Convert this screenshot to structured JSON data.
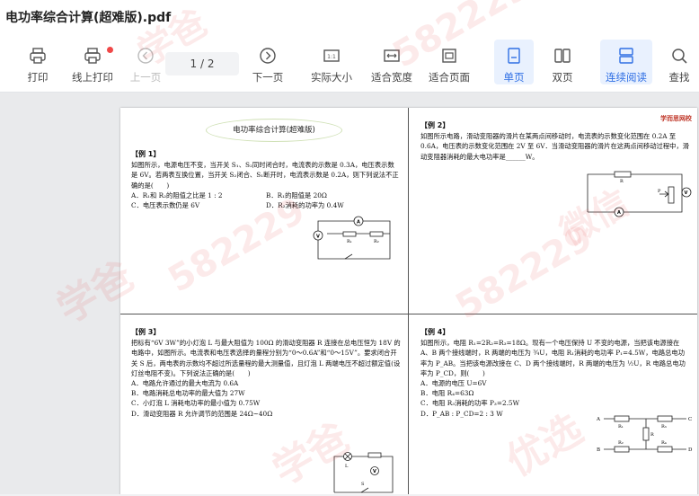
{
  "window": {
    "title": "电功率综合计算(超难版).pdf"
  },
  "toolbar": {
    "print": "打印",
    "online_print": "线上打印",
    "prev_page": "上一页",
    "page_indicator": "1 / 2",
    "next_page": "下一页",
    "actual_size": "实际大小",
    "fit_width": "适合宽度",
    "fit_page": "适合页面",
    "single_page": "单页",
    "double_page": "双页",
    "continuous": "连续阅读",
    "find": "查找"
  },
  "colors": {
    "accent": "#2f6fe4",
    "active_bg": "#e9f1fe",
    "badge": "#f04848"
  },
  "document": {
    "banner": "电功率综合计算(超难版)",
    "logo": "学而思网校",
    "q1": {
      "title": "【例 1】",
      "body": "如图所示，电源电压不变，当开关 S₁、S₂同时闭合时，电流表的示数是 0.3A，电压表示数是 6V。若两表互换位置，当开关 S₂闭合、S₁断开时，电流表示数是 0.2A，则下列说法不正确的是(　　)",
      "options": [
        "A．R₁和 R₂的阻值之比是 1 : 2",
        "B．R₁的阻值是 20Ω",
        "C．电压表示数仍是 6V",
        "D．R₂消耗的功率为 0.4W"
      ]
    },
    "q2": {
      "title": "【例 2】",
      "body": "如图所示电路，滑动变阻器的滑片在某两点间移动时，电流表的示数变化范围在 0.2A 至 0.6A，电压表的示数变化范围在 2V 至 6V．当滑动变阻器的滑片在这两点间移动过程中，滑动变阻器消耗的最大电功率是______W。"
    },
    "q3": {
      "title": "【例 3】",
      "body": "把标有“6V 3W”的小灯泡 L 与最大阻值为 100Ω 的滑动变阻器 R 连接在总电压恒为 18V 的电路中，如图所示。电流表和电压表选择的量程分别为“0～0.6A”和“0～15V”。要求闭合开关 S 后，两电表的示数均不超过所选量程的最大测量值，且灯泡 L 两端电压不超过额定值(设灯丝电阻不变)。下列说法正确的是(　　)",
      "options": [
        "A．电路允许通过的最大电流为 0.6A",
        "B．电路消耗总电功率的最大值为 27W",
        "C．小灯泡 L 消耗电功率的最小值为 0.75W",
        "D．滑动变阻器 R 允许调节的范围是 24Ω~40Ω"
      ]
    },
    "q4": {
      "title": "【例 4】",
      "body": "如图所示，电阻 R₁=2R₂=R₃=18Ω。现有一个电压保持 U 不变的电源，当把该电源接在 A、B 两个接线端时，R 两端的电压为 ¾U，电阻 R₁消耗的电功率 P₁=4.5W，电路总电功率为 P_AB。当把该电源改接在 C、D 两个接线端时，R 两端的电压为 ½U，R 电路总电功率为 P_CD，则(　　)",
      "options": [
        "A．电源的电压 U=6V",
        "B．电阻 R₄=63Ω",
        "C．电阻 R₃消耗的功率 P₃=2.5W",
        "D．P_AB : P_CD=2 : 3 W"
      ]
    }
  },
  "watermark": {
    "text1": "学爸",
    "text2": "582229",
    "text3": "微信",
    "text4": "优选"
  }
}
